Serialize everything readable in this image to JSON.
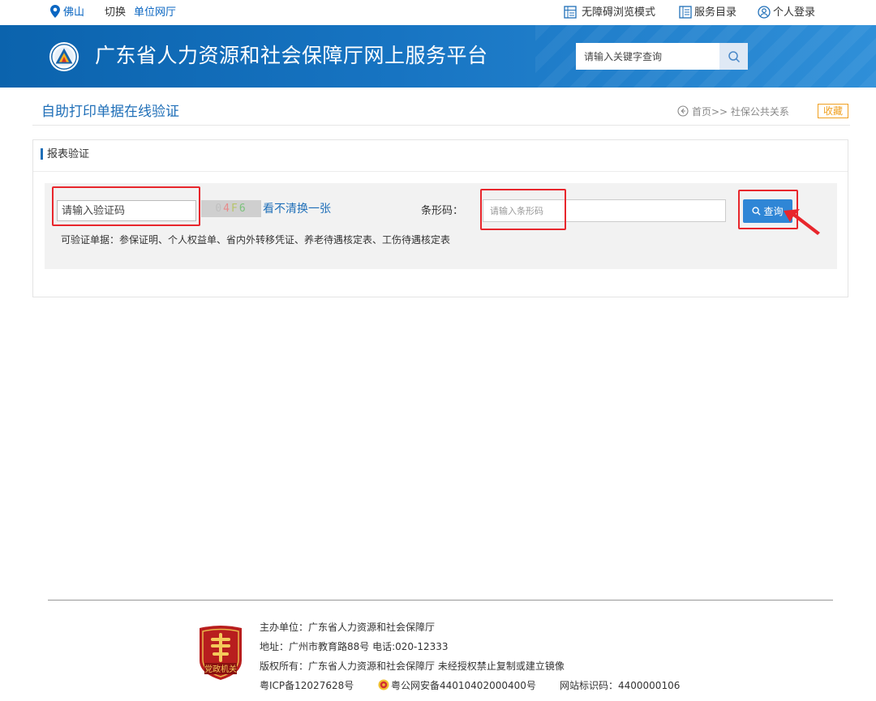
{
  "topbar": {
    "city": "佛山",
    "switch_label": "切换",
    "unit_hall": "单位网厅",
    "accessibility": "无障碍浏览模式",
    "service_catalog": "服务目录",
    "personal_login": "个人登录"
  },
  "banner": {
    "site_title": "广东省人力资源和社会保障厅网上服务平台",
    "search_placeholder": "请输入关键字查询"
  },
  "page": {
    "title": "自助打印单据在线验证",
    "breadcrumb": "首页>> 社保公共关系",
    "favorite": "收藏"
  },
  "form": {
    "section_title": "报表验证",
    "verify_placeholder": "请输入验证码",
    "captcha_chars": [
      {
        "ch": "0",
        "color": "#c0c0c0"
      },
      {
        "ch": "4",
        "color": "#e88a8a"
      },
      {
        "ch": "F",
        "color": "#b7c46a"
      },
      {
        "ch": "6",
        "color": "#7cc27c"
      }
    ],
    "refresh_link": "看不清换一张",
    "barcode_label": "条形码：",
    "barcode_placeholder": "请输入条形码",
    "query_label": "查询",
    "hint": "可验证单据：参保证明、个人权益单、省内外转移凭证、养老待遇核定表、工伤待遇核定表"
  },
  "footer": {
    "sponsor": "主办单位：广东省人力资源和社会保障厅",
    "address": "地址：广州市教育路88号 电话:020-12333",
    "copyright": "版权所有：广东省人力资源和社会保障厅 未经授权禁止复制或建立镜像",
    "icp": "粤ICP备12027628号",
    "police_record": "粤公网安备44010402000400号",
    "site_id": "网站标识码：4400000106",
    "badge_text": "党政机关"
  },
  "colors": {
    "accent": "#1f6fb8",
    "banner": "#1774c2",
    "favorite": "#f0a020",
    "query_button": "#2f86d6",
    "annotation_red": "#e8262c"
  }
}
